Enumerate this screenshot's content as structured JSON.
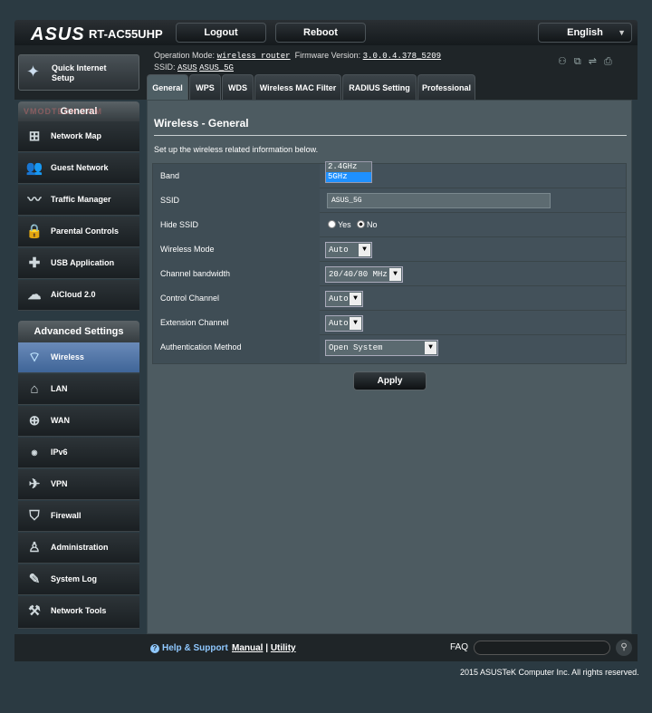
{
  "header": {
    "logo": "ASUS",
    "model": "RT-AC55UHP",
    "logout": "Logout",
    "reboot": "Reboot",
    "language": "English"
  },
  "info": {
    "op_mode_label": "Operation Mode:",
    "op_mode_value": "wireless router",
    "fw_label": "Firmware Version:",
    "fw_value": "3.0.0.4.378_5209",
    "ssid_label": "SSID:",
    "ssid_1": "ASUS",
    "ssid_2": "ASUS_5G"
  },
  "sidebar": {
    "qis_line1": "Quick Internet",
    "qis_line2": "Setup",
    "general_header": "General",
    "watermark": "VMODTECH.COM",
    "general_items": [
      {
        "label": "Network Map"
      },
      {
        "label": "Guest Network"
      },
      {
        "label": "Traffic Manager"
      },
      {
        "label": "Parental Controls"
      },
      {
        "label": "USB Application"
      },
      {
        "label": "AiCloud 2.0"
      }
    ],
    "advanced_header": "Advanced Settings",
    "advanced_items": [
      {
        "label": "Wireless"
      },
      {
        "label": "LAN"
      },
      {
        "label": "WAN"
      },
      {
        "label": "IPv6"
      },
      {
        "label": "VPN"
      },
      {
        "label": "Firewall"
      },
      {
        "label": "Administration"
      },
      {
        "label": "System Log"
      },
      {
        "label": "Network Tools"
      }
    ]
  },
  "tabs": [
    "General",
    "WPS",
    "WDS",
    "Wireless MAC Filter",
    "RADIUS Setting",
    "Professional"
  ],
  "main": {
    "title": "Wireless - General",
    "description": "Set up the wireless related information below.",
    "band_label": "Band",
    "band_options": [
      "2.4GHz",
      "5GHz"
    ],
    "ssid_label": "SSID",
    "ssid_value": "ASUS_5G",
    "hide_ssid_label": "Hide SSID",
    "yes": "Yes",
    "no": "No",
    "wireless_mode_label": "Wireless Mode",
    "wireless_mode_value": "Auto",
    "channel_bw_label": "Channel bandwidth",
    "channel_bw_value": "20/40/80 MHz",
    "control_channel_label": "Control Channel",
    "control_channel_value": "Auto",
    "extension_channel_label": "Extension Channel",
    "extension_channel_value": "Auto",
    "auth_label": "Authentication Method",
    "auth_value": "Open System",
    "apply": "Apply"
  },
  "footer": {
    "help": "Help & Support",
    "manual": "Manual",
    "sep": "|",
    "utility": "Utility",
    "faq": "FAQ",
    "copyright": "2015 ASUSTeK Computer Inc. All rights reserved."
  }
}
